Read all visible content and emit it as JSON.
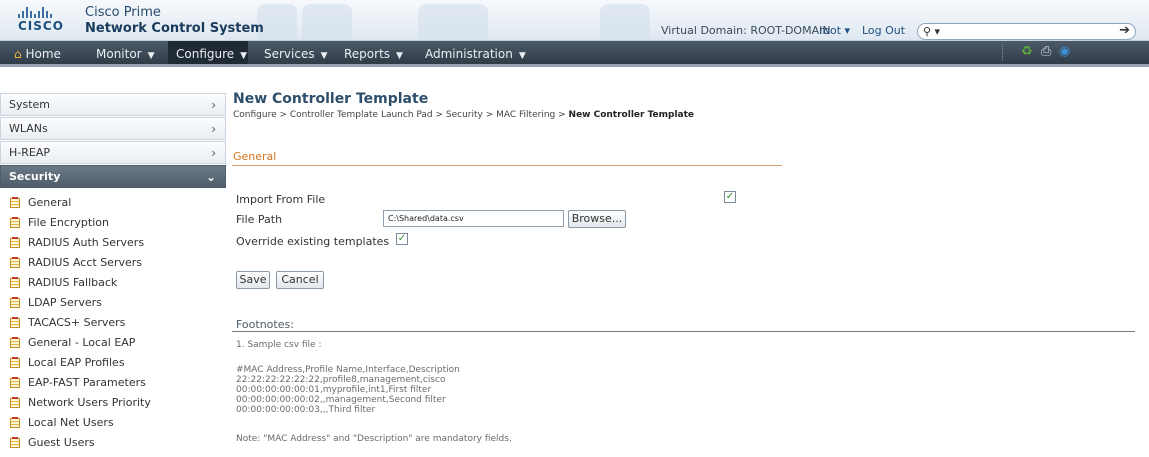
{
  "header": {
    "logo_text": "CISCO",
    "product_line1": "Cisco Prime",
    "product_line2": "Network Control System",
    "virtual_domain": "Virtual Domain: ROOT-DOMAIN",
    "user_menu": "root ▾",
    "logout": "Log Out",
    "search_placeholder": ""
  },
  "nav": {
    "items": [
      {
        "label": "Home",
        "icon": "home-icon"
      },
      {
        "label": "Monitor"
      },
      {
        "label": "Configure",
        "active": true
      },
      {
        "label": "Services"
      },
      {
        "label": "Reports"
      },
      {
        "label": "Administration"
      }
    ],
    "tools": [
      "refresh-icon",
      "print-icon",
      "help-icon"
    ]
  },
  "sidebar": {
    "sections": [
      {
        "label": "System"
      },
      {
        "label": "WLANs"
      },
      {
        "label": "H-REAP"
      },
      {
        "label": "Security",
        "expanded": true
      }
    ],
    "items": [
      "General",
      "File Encryption",
      "RADIUS Auth Servers",
      "RADIUS Acct Servers",
      "RADIUS Fallback",
      "LDAP Servers",
      "TACACS+ Servers",
      "General - Local EAP",
      "Local EAP Profiles",
      "EAP-FAST Parameters",
      "Network Users Priority",
      "Local Net Users",
      "Guest Users"
    ]
  },
  "main": {
    "title": "New Controller Template",
    "breadcrumb_prefix": "Configure > Controller Template Launch Pad > Security > MAC Filtering >",
    "breadcrumb_current": "New Controller Template",
    "section_title": "General",
    "form": {
      "import_label": "Import From File",
      "import_checked": true,
      "file_path_label": "File Path",
      "file_path_value": "C:\\Shared\\data.csv",
      "browse_label": "Browse...",
      "override_label": "Override existing templates",
      "override_checked": true,
      "save_label": "Save",
      "cancel_label": "Cancel"
    },
    "footnotes": {
      "title": "Footnotes:",
      "note1": "1. Sample csv file :",
      "sample_lines": [
        "#MAC Address,Profile Name,Interface,Description",
        "22:22:22:22:22:22,profile8,management,cisco",
        "00:00:00:00:00:01,myprofile,int1,First filter",
        "00:00:00:00:00:02,,management,Second filter",
        "00:00:00:00:00:03,,,Third filter"
      ],
      "note2": "Note: \"MAC Address\" and \"Description\" are mandatory fields."
    }
  }
}
